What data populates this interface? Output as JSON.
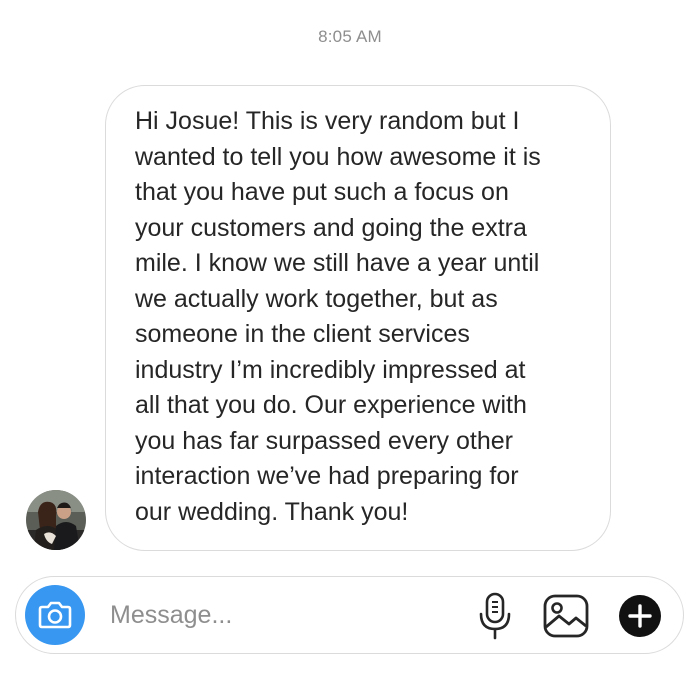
{
  "thread": {
    "timestamp": "8:05 AM",
    "messages": [
      {
        "sender": "other",
        "text": "Hi Josue! This is very random but I\nwanted to tell you how awesome it is\nthat you have put such a focus on\nyour customers and going the extra\nmile. I know we still have a year until\nwe actually work together, but as\nsomeone in the client services\nindustry I’m incredibly impressed at\nall that you do. Our experience with\nyou has far surpassed every other\ninteraction we’ve had preparing for\nour wedding. Thank you!"
      }
    ]
  },
  "composer": {
    "placeholder": "Message...",
    "value": "",
    "icons": {
      "camera": "camera-icon",
      "mic": "microphone-icon",
      "gallery": "image-icon",
      "more": "plus-circle-icon"
    },
    "camera_color": "#3897f0"
  }
}
